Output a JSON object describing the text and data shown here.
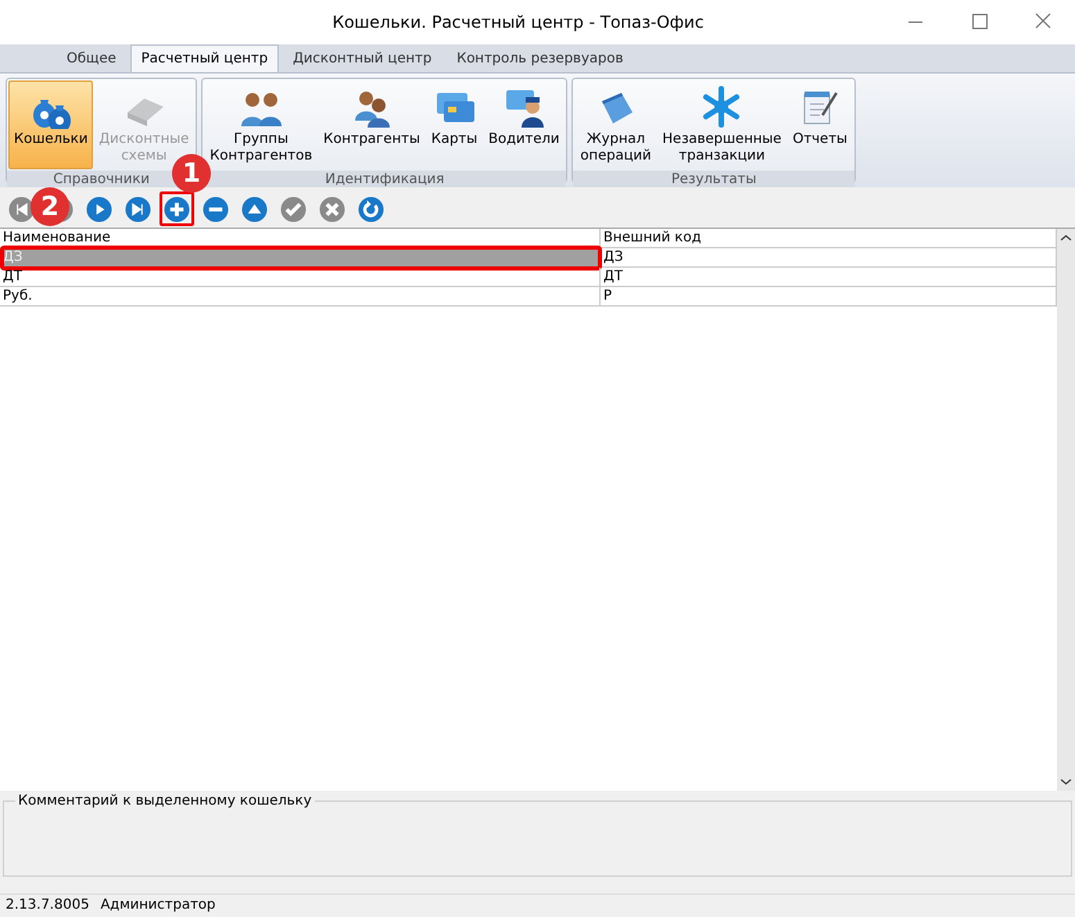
{
  "window": {
    "title": "Кошельки. Расчетный центр - Топаз-Офис"
  },
  "tabs": [
    {
      "label": "Общее",
      "selected": false
    },
    {
      "label": "Расчетный центр",
      "selected": true
    },
    {
      "label": "Дисконтный центр",
      "selected": false
    },
    {
      "label": "Контроль резервуаров",
      "selected": false
    }
  ],
  "ribbon_groups": [
    {
      "title": "Справочники",
      "buttons": [
        {
          "kind": "wallets",
          "label": "Кошельки",
          "selected": true,
          "disabled": false
        },
        {
          "kind": "discount",
          "label": "Дисконтные\nсхемы",
          "selected": false,
          "disabled": true
        }
      ]
    },
    {
      "title": "Идентификация",
      "buttons": [
        {
          "kind": "groups",
          "label": "Группы\nКонтрагентов",
          "selected": false,
          "disabled": false
        },
        {
          "kind": "people",
          "label": "Контрагенты",
          "selected": false,
          "disabled": false
        },
        {
          "kind": "cards",
          "label": "Карты",
          "selected": false,
          "disabled": false
        },
        {
          "kind": "driver",
          "label": "Водители",
          "selected": false,
          "disabled": false
        }
      ]
    },
    {
      "title": "Результаты",
      "buttons": [
        {
          "kind": "journal",
          "label": "Журнал\nопераций",
          "selected": false,
          "disabled": false
        },
        {
          "kind": "snowflake",
          "label": "Незавершенные\nтранзакции",
          "selected": false,
          "disabled": false
        },
        {
          "kind": "reports",
          "label": "Отчеты",
          "selected": false,
          "disabled": false
        }
      ]
    }
  ],
  "toolbar": {
    "badge": "1",
    "buttons": [
      {
        "kind": "first",
        "disabled": true,
        "marked": false
      },
      {
        "kind": "prev",
        "disabled": true,
        "marked": false
      },
      {
        "kind": "next",
        "disabled": false,
        "marked": false
      },
      {
        "kind": "last",
        "disabled": false,
        "marked": false
      },
      {
        "kind": "add",
        "disabled": false,
        "marked": true
      },
      {
        "kind": "remove",
        "disabled": false,
        "marked": false
      },
      {
        "kind": "up",
        "disabled": false,
        "marked": false
      },
      {
        "kind": "confirm",
        "disabled": true,
        "marked": false
      },
      {
        "kind": "cancel",
        "disabled": true,
        "marked": false
      },
      {
        "kind": "refresh",
        "disabled": false,
        "marked": false
      }
    ]
  },
  "table": {
    "badge": "2",
    "columns": [
      "Наименование",
      "Внешний код"
    ],
    "rows": [
      {
        "cells": [
          "ДЗ",
          "ДЗ"
        ],
        "selected": true,
        "marked": true
      },
      {
        "cells": [
          "ДТ",
          "ДТ"
        ],
        "selected": false,
        "marked": false
      },
      {
        "cells": [
          "Руб.",
          "Р"
        ],
        "selected": false,
        "marked": false
      }
    ]
  },
  "comment": {
    "title": "Комментарий к выделенному кошельку"
  },
  "status_bar": [
    "2.13.7.8005",
    "Администратор"
  ]
}
